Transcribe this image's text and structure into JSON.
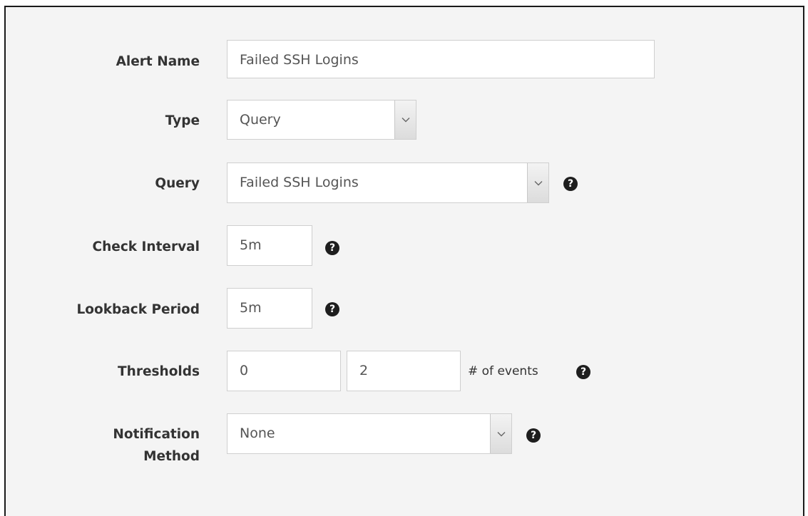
{
  "form": {
    "alert_name": {
      "label": "Alert Name",
      "value": "Failed SSH Logins"
    },
    "type": {
      "label": "Type",
      "selected": "Query"
    },
    "query": {
      "label": "Query",
      "selected": "Failed SSH Logins"
    },
    "check_interval": {
      "label": "Check Interval",
      "value": "5m"
    },
    "lookback_period": {
      "label": "Lookback Period",
      "value": "5m"
    },
    "thresholds": {
      "label": "Thresholds",
      "min_value": "0",
      "max_value": "2",
      "suffix": "# of events"
    },
    "notification_method": {
      "label_line1": "Notification",
      "label_line2": "Method",
      "selected": "None"
    }
  },
  "icons": {
    "help": "question-circle-icon",
    "dropdown": "chevron-down-icon"
  },
  "colors": {
    "background": "#f4f4f4",
    "field_border": "#cfcfcf",
    "label_text": "#333333",
    "value_text": "#555555",
    "help_icon": "#1e1e1e"
  }
}
